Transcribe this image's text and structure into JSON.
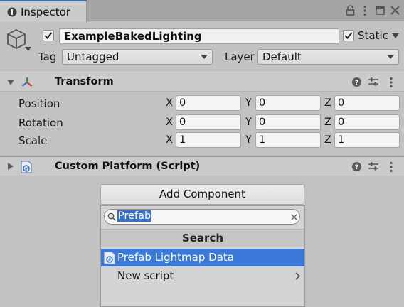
{
  "tab": {
    "title": "Inspector",
    "icon": "info-icon",
    "controls": [
      "lock-icon",
      "menu-dots-icon",
      "maximize-icon",
      "close-icon"
    ]
  },
  "object": {
    "active": true,
    "name": "ExampleBakedLighting",
    "static_label": "Static",
    "static_checked": true,
    "tag_label": "Tag",
    "tag_value": "Untagged",
    "layer_label": "Layer",
    "layer_value": "Default"
  },
  "transform": {
    "title": "Transform",
    "expanded": true,
    "rows": [
      {
        "label": "Position",
        "x": "0",
        "y": "0",
        "z": "0"
      },
      {
        "label": "Rotation",
        "x": "0",
        "y": "0",
        "z": "0"
      },
      {
        "label": "Scale",
        "x": "1",
        "y": "1",
        "z": "1"
      }
    ],
    "axis_labels": {
      "x": "X",
      "y": "Y",
      "z": "Z"
    }
  },
  "script_component": {
    "title": "Custom Platform (Script)",
    "expanded": false
  },
  "add_component": {
    "button_label": "Add Component",
    "search_value": "Prefab",
    "popup_header": "Search",
    "results": [
      {
        "label": "Prefab Lightmap Data",
        "selected": true,
        "icon": "csharp-script-icon"
      },
      {
        "label": "New script",
        "selected": false,
        "submenu": true
      }
    ]
  },
  "colors": {
    "accent": "#3a79d8",
    "tab_highlight": "#3a72b0",
    "panel_bg": "#c2c2c2"
  }
}
